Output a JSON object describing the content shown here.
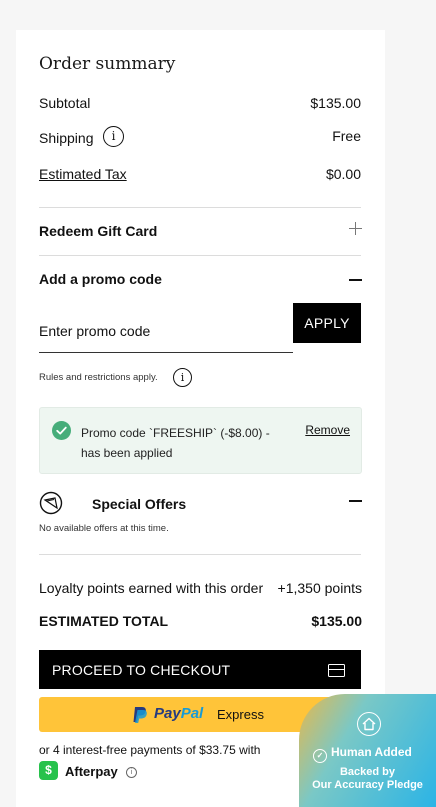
{
  "summary": {
    "title": "Order summary",
    "subtotal_label": "Subtotal",
    "subtotal_value": "$135.00",
    "shipping_label": "Shipping",
    "shipping_info": "i",
    "shipping_value": "Free",
    "tax_label": "Estimated Tax",
    "tax_value": "$0.00"
  },
  "gift_card": {
    "label": "Redeem Gift Card",
    "icon": "plus-icon"
  },
  "promo": {
    "heading": "Add a promo code",
    "icon": "minus-icon",
    "placeholder": "Enter promo code",
    "apply_label": "APPLY",
    "rules_text": "Rules and restrictions apply.",
    "rules_info": "i",
    "applied_text": "Promo code `FREESHIP` (-$8.00) - has been applied",
    "remove_label": "Remove",
    "applied_color": "#46ad7a"
  },
  "offers": {
    "title": "Special Offers",
    "empty_text": "No available offers at this time."
  },
  "loyalty": {
    "label": "Loyalty points earned with this order",
    "value": "+1,350 points"
  },
  "total": {
    "label": "ESTIMATED TOTAL",
    "value": "$135.00"
  },
  "checkout": {
    "label": "PROCEED TO CHECKOUT",
    "icon": "credit-card-icon"
  },
  "paypal": {
    "brand_pay": "Pay",
    "brand_pal": "Pal",
    "label": "Express",
    "color": "#ffc439"
  },
  "afterpay": {
    "line": "or 4 interest-free payments of $33.75 with",
    "logo_glyph": "$",
    "name": "Afterpay",
    "info": "i"
  },
  "pledge": {
    "title": "Human Added",
    "sub1": "Backed by",
    "sub2": "Our Accuracy Pledge"
  }
}
